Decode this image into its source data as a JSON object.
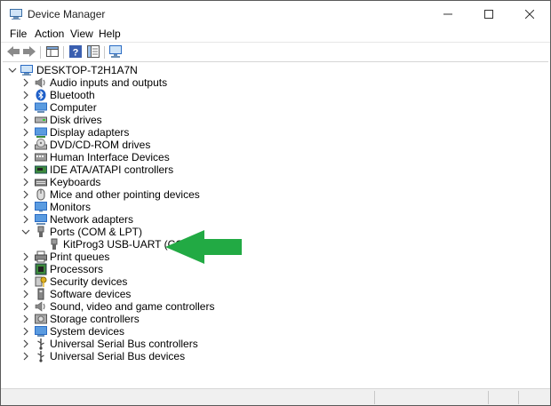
{
  "window": {
    "title": "Device Manager"
  },
  "menu": [
    "File",
    "Action",
    "View",
    "Help"
  ],
  "tree": {
    "root": "DESKTOP-T2H1A7N",
    "items": [
      {
        "label": "Audio inputs and outputs",
        "icon": "speaker-icon"
      },
      {
        "label": "Bluetooth",
        "icon": "bluetooth-icon"
      },
      {
        "label": "Computer",
        "icon": "computer-icon"
      },
      {
        "label": "Disk drives",
        "icon": "disk-drive-icon"
      },
      {
        "label": "Display adapters",
        "icon": "display-adapter-icon"
      },
      {
        "label": "DVD/CD-ROM drives",
        "icon": "dvd-drive-icon"
      },
      {
        "label": "Human Interface Devices",
        "icon": "hid-icon"
      },
      {
        "label": "IDE ATA/ATAPI controllers",
        "icon": "ide-controller-icon"
      },
      {
        "label": "Keyboards",
        "icon": "keyboard-icon"
      },
      {
        "label": "Mice and other pointing devices",
        "icon": "mouse-icon"
      },
      {
        "label": "Monitors",
        "icon": "monitor-icon"
      },
      {
        "label": "Network adapters",
        "icon": "network-adapter-icon"
      },
      {
        "label": "Ports (COM & LPT)",
        "icon": "port-icon",
        "expanded": true,
        "children": [
          {
            "label": "KitProg3 USB-UART (COM6)",
            "icon": "port-icon"
          }
        ]
      },
      {
        "label": "Print queues",
        "icon": "printer-icon"
      },
      {
        "label": "Processors",
        "icon": "processor-icon"
      },
      {
        "label": "Security devices",
        "icon": "security-key-icon"
      },
      {
        "label": "Software devices",
        "icon": "software-device-icon"
      },
      {
        "label": "Sound, video and game controllers",
        "icon": "speaker-icon"
      },
      {
        "label": "Storage controllers",
        "icon": "storage-controller-icon"
      },
      {
        "label": "System devices",
        "icon": "system-device-icon"
      },
      {
        "label": "Universal Serial Bus controllers",
        "icon": "usb-icon"
      },
      {
        "label": "Universal Serial Bus devices",
        "icon": "usb-icon"
      }
    ]
  },
  "colors": {
    "annotation_arrow": "#22aa44",
    "icon_blue": "#2b6cc4"
  }
}
